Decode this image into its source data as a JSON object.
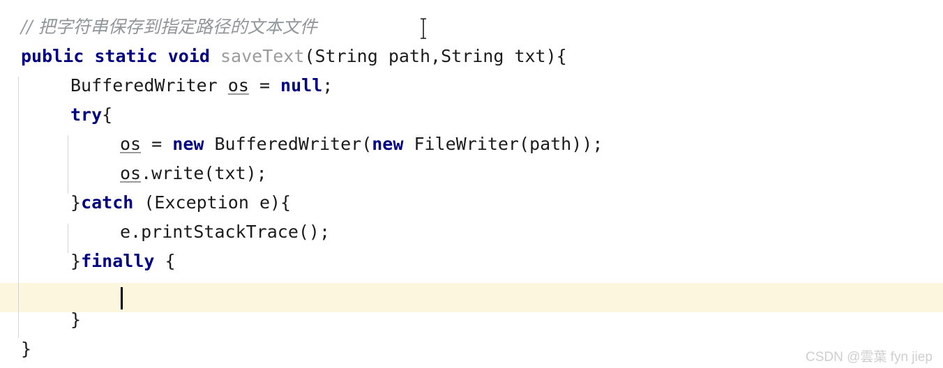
{
  "editor": {
    "background_color": "#ffffff",
    "current_line_highlight_color": "#fdf6de",
    "indent_guide_color": "#d4d4d4",
    "caret_color": "#000000",
    "keyword_color": "#000080",
    "comment_color": "#909699",
    "method_declaration_color": "#9c9c9c",
    "plain_text_color": "#1c1c1c"
  },
  "code": {
    "lines": [
      {
        "id": "line-comment",
        "indent": 0,
        "segments": [
          {
            "kind": "comment",
            "text": "// 把字符串保存到指定路径的文本文件"
          }
        ]
      },
      {
        "id": "line-method-signature",
        "indent": 0,
        "segments": [
          {
            "kind": "keyword",
            "text": "public static void"
          },
          {
            "kind": "plain",
            "text": " "
          },
          {
            "kind": "method-decl",
            "text": "saveText"
          },
          {
            "kind": "plain",
            "text": "(String path,String txt){"
          }
        ]
      },
      {
        "id": "line-declare-writer",
        "indent": 1,
        "segments": [
          {
            "kind": "plain",
            "text": "BufferedWriter "
          },
          {
            "kind": "var",
            "text": "os"
          },
          {
            "kind": "plain",
            "text": " = "
          },
          {
            "kind": "keyword",
            "text": "null"
          },
          {
            "kind": "plain",
            "text": ";"
          }
        ]
      },
      {
        "id": "line-try-open",
        "indent": 1,
        "segments": [
          {
            "kind": "keyword",
            "text": "try"
          },
          {
            "kind": "plain",
            "text": "{"
          }
        ]
      },
      {
        "id": "line-assign-writer",
        "indent": 2,
        "segments": [
          {
            "kind": "var",
            "text": "os"
          },
          {
            "kind": "plain",
            "text": " = "
          },
          {
            "kind": "keyword",
            "text": "new"
          },
          {
            "kind": "plain",
            "text": " BufferedWriter("
          },
          {
            "kind": "keyword",
            "text": "new"
          },
          {
            "kind": "plain",
            "text": " FileWriter(path));"
          }
        ]
      },
      {
        "id": "line-write-txt",
        "indent": 2,
        "segments": [
          {
            "kind": "var",
            "text": "os"
          },
          {
            "kind": "plain",
            "text": ".write(txt);"
          }
        ]
      },
      {
        "id": "line-catch",
        "indent": 1,
        "segments": [
          {
            "kind": "plain",
            "text": "}"
          },
          {
            "kind": "keyword",
            "text": "catch"
          },
          {
            "kind": "plain",
            "text": " (Exception e){"
          }
        ]
      },
      {
        "id": "line-print-stacktrace",
        "indent": 2,
        "segments": [
          {
            "kind": "plain",
            "text": "e.printStackTrace();"
          }
        ]
      },
      {
        "id": "line-finally",
        "indent": 1,
        "segments": [
          {
            "kind": "plain",
            "text": "}"
          },
          {
            "kind": "keyword",
            "text": "finally"
          },
          {
            "kind": "plain",
            "text": " {"
          }
        ]
      },
      {
        "id": "line-empty-caret",
        "indent": 2,
        "segments": [
          {
            "kind": "plain",
            "text": ""
          }
        ]
      },
      {
        "id": "line-close-finally",
        "indent": 1,
        "segments": [
          {
            "kind": "plain",
            "text": "}"
          }
        ]
      },
      {
        "id": "line-close-method",
        "indent": 0,
        "segments": [
          {
            "kind": "plain",
            "text": "}"
          }
        ]
      }
    ]
  },
  "caret": {
    "name": "text-insertion-caret",
    "line_id": "line-empty-caret"
  },
  "mouse": {
    "name": "ibeam-pointer"
  },
  "watermark": {
    "text": "CSDN @雲葉 fyn jiep"
  }
}
